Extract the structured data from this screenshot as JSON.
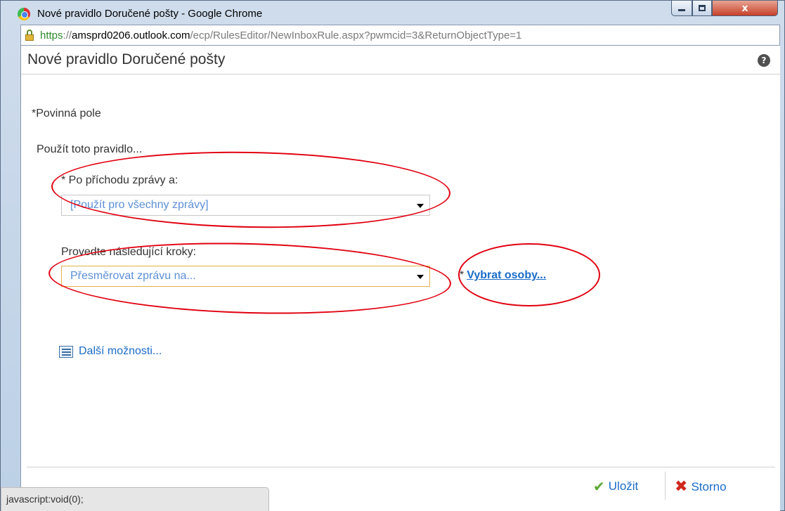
{
  "window": {
    "title": "Nové pravidlo Doručené pošty - Google Chrome",
    "minimize_label": "",
    "maximize_label": "",
    "close_label": "x"
  },
  "address": {
    "scheme": "https",
    "separator": "://",
    "host": "amsprd0206.outlook.com",
    "path": "/ecp/RulesEditor/NewInboxRule.aspx?pwmcid=3&ReturnObjectType=1"
  },
  "dialog": {
    "title": "Nové pravidlo Doručené pošty",
    "help_label": "?",
    "required_note": "*Povinná pole",
    "apply_rule_label": "Použít toto pravidlo...",
    "condition": {
      "label": "* Po příchodu zprávy a:",
      "selected": "[Použít pro všechny zprávy]"
    },
    "action": {
      "label": "Provedte následující kroky:",
      "selected": "Přesměrovat zprávu na...",
      "required_marker": "*",
      "pick_people_link": "Vybrat osoby..."
    },
    "more_options": "Další možnosti...",
    "save_label": "Uložit",
    "cancel_label": "Storno"
  },
  "status_bar": {
    "text": "javascript:void(0);"
  },
  "colors": {
    "link": "#1a6cc8",
    "select_text": "#5b8fd6",
    "annotation": "#e1000f",
    "save_check": "#5aa832",
    "cancel_x": "#d0261c"
  }
}
